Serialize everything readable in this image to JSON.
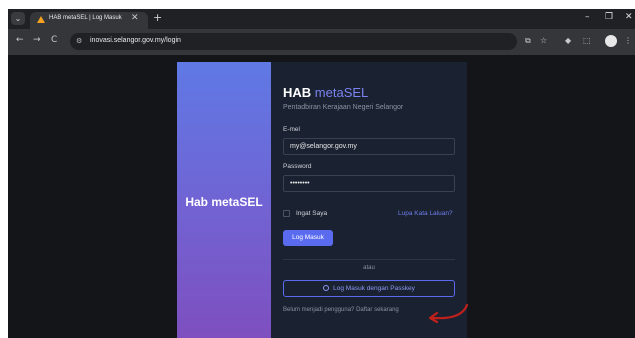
{
  "browser": {
    "tab_title": "HAB metaSEL | Log Masuk",
    "url": "inovasi.selangor.gov.my/login",
    "menu_glyph": "⌄",
    "close_glyph": "✕",
    "new_tab_glyph": "+",
    "minimize_glyph": "–",
    "maximize_glyph": "❐",
    "window_close_glyph": "✕",
    "back_glyph": "←",
    "forward_glyph": "→",
    "reload_glyph": "C",
    "site_info_glyph": "⚙",
    "cast_glyph": "⧉",
    "bookmark_glyph": "☆",
    "extension_glyph": "◆",
    "puzzle_glyph": "⬚",
    "more_glyph": "⋮"
  },
  "page": {
    "left_brand": "Hab metaSEL",
    "brand_bold": "HAB",
    "brand_accent": "metaSEL",
    "subtitle": "Pentadbiran Kerajaan Negeri Selangor",
    "email_label": "E-mel",
    "email_value": "my@selangor.gov.my",
    "password_label": "Password",
    "password_value": "••••••••",
    "remember_label": "Ingat Saya",
    "forgot_link": "Lupa Kata Laluan?",
    "login_button": "Log Masuk",
    "or_text": "atau",
    "passkey_button": "Log Masuk dengan Passkey",
    "register_prompt": "Belum menjadi pengguna?",
    "register_link": "Daftar sekarang"
  },
  "colors": {
    "accent": "#5b6bef",
    "gradient_top": "#5f79e5",
    "gradient_bottom": "#7e4fbf",
    "annotation_arrow": "#c0201c"
  }
}
